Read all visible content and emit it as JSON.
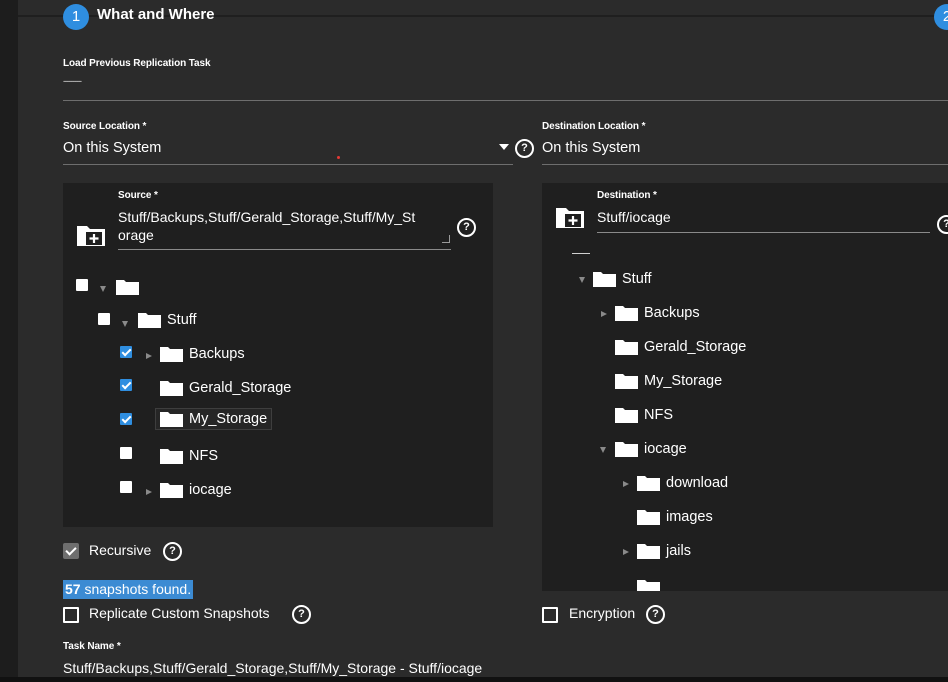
{
  "step": {
    "number": "1",
    "title": "What and Where",
    "next_number": "2"
  },
  "load_previous": {
    "label": "Load Previous Replication Task",
    "value": "---------"
  },
  "source_location": {
    "label": "Source Location *",
    "value": "On this System"
  },
  "destination_location": {
    "label": "Destination Location *",
    "value": "On this System"
  },
  "source": {
    "label": "Source *",
    "value_line1": "Stuff/Backups,Stuff/Gerald_Storage,Stuff/My_St",
    "value_line2": "orage",
    "tree": {
      "root_label": "",
      "pool_label": "Stuff",
      "items": [
        {
          "label": "Backups",
          "checked": true,
          "expandable": true
        },
        {
          "label": "Gerald_Storage",
          "checked": true,
          "expandable": false
        },
        {
          "label": "My_Storage",
          "checked": true,
          "expandable": false,
          "selected": true
        },
        {
          "label": "NFS",
          "checked": false,
          "expandable": false
        },
        {
          "label": "iocage",
          "checked": false,
          "expandable": true
        }
      ]
    }
  },
  "destination": {
    "label": "Destination *",
    "value": "Stuff/iocage",
    "tree": {
      "pool_label": "Stuff",
      "items": [
        "Backups",
        "Gerald_Storage",
        "My_Storage",
        "NFS",
        "iocage"
      ],
      "iocage_children": [
        "download",
        "images",
        "jails"
      ]
    }
  },
  "recursive": {
    "label": "Recursive",
    "checked": true
  },
  "snapshots_found": {
    "count": "57",
    "text": " snapshots found."
  },
  "replicate_custom": {
    "label": "Replicate Custom Snapshots",
    "checked": false
  },
  "encryption": {
    "label": "Encryption",
    "checked": false
  },
  "task_name": {
    "label": "Task Name *",
    "value": "Stuff/Backups,Stuff/Gerald_Storage,Stuff/My_Storage - Stuff/iocage"
  },
  "help_glyph": "?",
  "icons": [
    "folder-icon",
    "add-folder-icon",
    "help-icon",
    "expand-arrow-icon",
    "dropdown-caret-icon",
    "checkbox-icon"
  ],
  "colors": {
    "accent": "#2f8ee0",
    "background": "#2b2b2b",
    "panel": "#1f1f1f",
    "highlight": "#3c8bd3"
  }
}
